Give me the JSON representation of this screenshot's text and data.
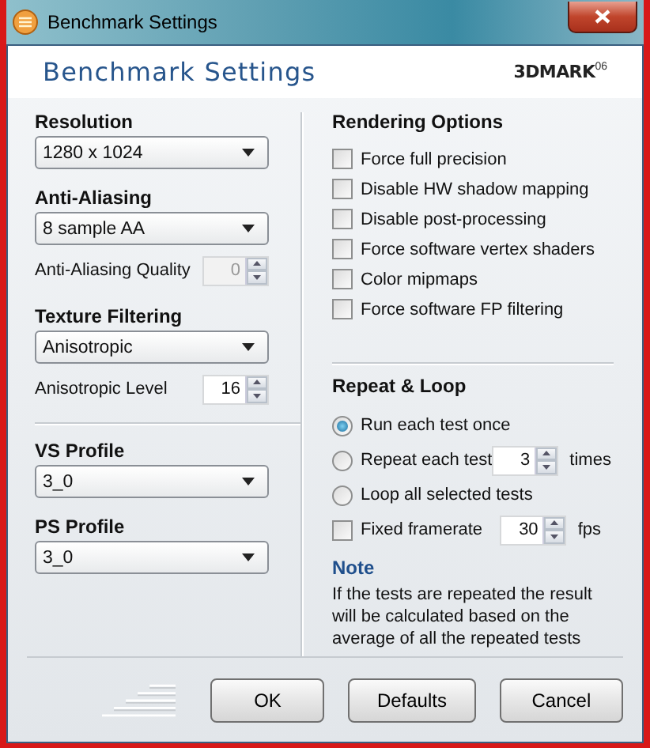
{
  "window": {
    "title": "Benchmark Settings"
  },
  "header": {
    "title": "Benchmark Settings",
    "logo": "3DMARK",
    "logo_suffix": "06"
  },
  "left_groups": [
    [
      {
        "kind": "select",
        "label": "Resolution",
        "value": "1280 x 1024"
      },
      {
        "kind": "select",
        "label": "Anti-Aliasing",
        "value": "8 sample AA"
      },
      {
        "kind": "spinner",
        "label": "Anti-Aliasing Quality",
        "value": "0",
        "disabled": true
      },
      {
        "kind": "select",
        "label": "Texture Filtering",
        "value": "Anisotropic"
      },
      {
        "kind": "spinner",
        "label": "Anisotropic Level",
        "value": "16",
        "disabled": false
      }
    ],
    [
      {
        "kind": "select",
        "label": "VS Profile",
        "value": "3_0"
      },
      {
        "kind": "select",
        "label": "PS Profile",
        "value": "3_0"
      }
    ]
  ],
  "rendering_options": {
    "title": "Rendering Options",
    "options": [
      {
        "label": "Force full precision",
        "checked": false
      },
      {
        "label": "Disable HW shadow mapping",
        "checked": false
      },
      {
        "label": "Disable post-processing",
        "checked": false
      },
      {
        "label": "Force software vertex shaders",
        "checked": false
      },
      {
        "label": "Color mipmaps",
        "checked": false
      },
      {
        "label": "Force software FP filtering",
        "checked": false
      }
    ]
  },
  "repeat_loop": {
    "title": "Repeat & Loop",
    "rows": [
      {
        "kind": "radio",
        "label": "Run each test once",
        "selected": true
      },
      {
        "kind": "radio",
        "label": "Repeat each test",
        "selected": false,
        "spinner": {
          "value": "3",
          "disabled": false
        },
        "unit": "times"
      },
      {
        "kind": "radio",
        "label": "Loop all selected tests",
        "selected": false
      },
      {
        "kind": "checkbox",
        "label": "Fixed framerate",
        "checked": false,
        "spinner": {
          "value": "30",
          "disabled": false
        },
        "unit": "fps"
      }
    ]
  },
  "note": {
    "title": "Note",
    "text": "If the tests are repeated the result will be calculated based on the average of all the repeated tests"
  },
  "buttons": [
    {
      "label": "OK"
    },
    {
      "label": "Defaults"
    },
    {
      "label": "Cancel"
    }
  ]
}
